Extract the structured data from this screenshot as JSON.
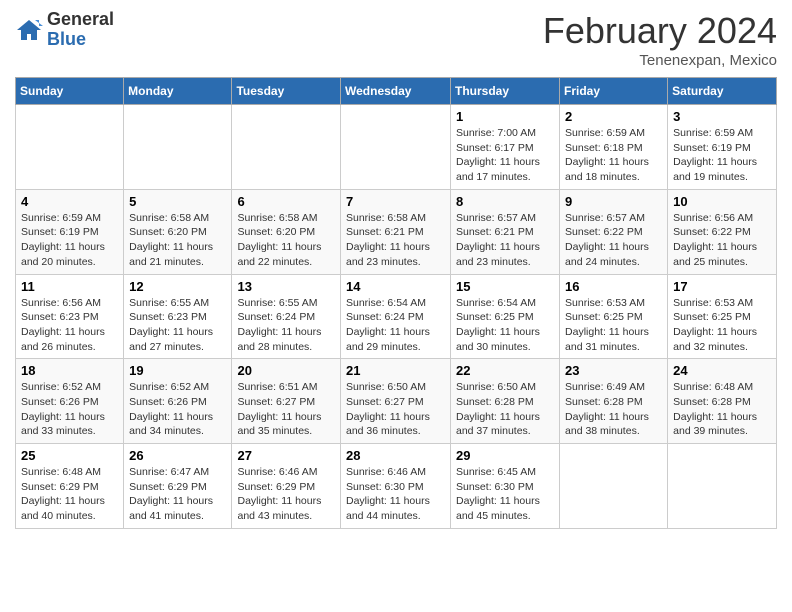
{
  "header": {
    "logo_general": "General",
    "logo_blue": "Blue",
    "month_year": "February 2024",
    "location": "Tenenexpan, Mexico"
  },
  "days_of_week": [
    "Sunday",
    "Monday",
    "Tuesday",
    "Wednesday",
    "Thursday",
    "Friday",
    "Saturday"
  ],
  "weeks": [
    [
      {
        "num": "",
        "info": ""
      },
      {
        "num": "",
        "info": ""
      },
      {
        "num": "",
        "info": ""
      },
      {
        "num": "",
        "info": ""
      },
      {
        "num": "1",
        "info": "Sunrise: 7:00 AM\nSunset: 6:17 PM\nDaylight: 11 hours and 17 minutes."
      },
      {
        "num": "2",
        "info": "Sunrise: 6:59 AM\nSunset: 6:18 PM\nDaylight: 11 hours and 18 minutes."
      },
      {
        "num": "3",
        "info": "Sunrise: 6:59 AM\nSunset: 6:19 PM\nDaylight: 11 hours and 19 minutes."
      }
    ],
    [
      {
        "num": "4",
        "info": "Sunrise: 6:59 AM\nSunset: 6:19 PM\nDaylight: 11 hours and 20 minutes."
      },
      {
        "num": "5",
        "info": "Sunrise: 6:58 AM\nSunset: 6:20 PM\nDaylight: 11 hours and 21 minutes."
      },
      {
        "num": "6",
        "info": "Sunrise: 6:58 AM\nSunset: 6:20 PM\nDaylight: 11 hours and 22 minutes."
      },
      {
        "num": "7",
        "info": "Sunrise: 6:58 AM\nSunset: 6:21 PM\nDaylight: 11 hours and 23 minutes."
      },
      {
        "num": "8",
        "info": "Sunrise: 6:57 AM\nSunset: 6:21 PM\nDaylight: 11 hours and 23 minutes."
      },
      {
        "num": "9",
        "info": "Sunrise: 6:57 AM\nSunset: 6:22 PM\nDaylight: 11 hours and 24 minutes."
      },
      {
        "num": "10",
        "info": "Sunrise: 6:56 AM\nSunset: 6:22 PM\nDaylight: 11 hours and 25 minutes."
      }
    ],
    [
      {
        "num": "11",
        "info": "Sunrise: 6:56 AM\nSunset: 6:23 PM\nDaylight: 11 hours and 26 minutes."
      },
      {
        "num": "12",
        "info": "Sunrise: 6:55 AM\nSunset: 6:23 PM\nDaylight: 11 hours and 27 minutes."
      },
      {
        "num": "13",
        "info": "Sunrise: 6:55 AM\nSunset: 6:24 PM\nDaylight: 11 hours and 28 minutes."
      },
      {
        "num": "14",
        "info": "Sunrise: 6:54 AM\nSunset: 6:24 PM\nDaylight: 11 hours and 29 minutes."
      },
      {
        "num": "15",
        "info": "Sunrise: 6:54 AM\nSunset: 6:25 PM\nDaylight: 11 hours and 30 minutes."
      },
      {
        "num": "16",
        "info": "Sunrise: 6:53 AM\nSunset: 6:25 PM\nDaylight: 11 hours and 31 minutes."
      },
      {
        "num": "17",
        "info": "Sunrise: 6:53 AM\nSunset: 6:25 PM\nDaylight: 11 hours and 32 minutes."
      }
    ],
    [
      {
        "num": "18",
        "info": "Sunrise: 6:52 AM\nSunset: 6:26 PM\nDaylight: 11 hours and 33 minutes."
      },
      {
        "num": "19",
        "info": "Sunrise: 6:52 AM\nSunset: 6:26 PM\nDaylight: 11 hours and 34 minutes."
      },
      {
        "num": "20",
        "info": "Sunrise: 6:51 AM\nSunset: 6:27 PM\nDaylight: 11 hours and 35 minutes."
      },
      {
        "num": "21",
        "info": "Sunrise: 6:50 AM\nSunset: 6:27 PM\nDaylight: 11 hours and 36 minutes."
      },
      {
        "num": "22",
        "info": "Sunrise: 6:50 AM\nSunset: 6:28 PM\nDaylight: 11 hours and 37 minutes."
      },
      {
        "num": "23",
        "info": "Sunrise: 6:49 AM\nSunset: 6:28 PM\nDaylight: 11 hours and 38 minutes."
      },
      {
        "num": "24",
        "info": "Sunrise: 6:48 AM\nSunset: 6:28 PM\nDaylight: 11 hours and 39 minutes."
      }
    ],
    [
      {
        "num": "25",
        "info": "Sunrise: 6:48 AM\nSunset: 6:29 PM\nDaylight: 11 hours and 40 minutes."
      },
      {
        "num": "26",
        "info": "Sunrise: 6:47 AM\nSunset: 6:29 PM\nDaylight: 11 hours and 41 minutes."
      },
      {
        "num": "27",
        "info": "Sunrise: 6:46 AM\nSunset: 6:29 PM\nDaylight: 11 hours and 43 minutes."
      },
      {
        "num": "28",
        "info": "Sunrise: 6:46 AM\nSunset: 6:30 PM\nDaylight: 11 hours and 44 minutes."
      },
      {
        "num": "29",
        "info": "Sunrise: 6:45 AM\nSunset: 6:30 PM\nDaylight: 11 hours and 45 minutes."
      },
      {
        "num": "",
        "info": ""
      },
      {
        "num": "",
        "info": ""
      }
    ]
  ]
}
